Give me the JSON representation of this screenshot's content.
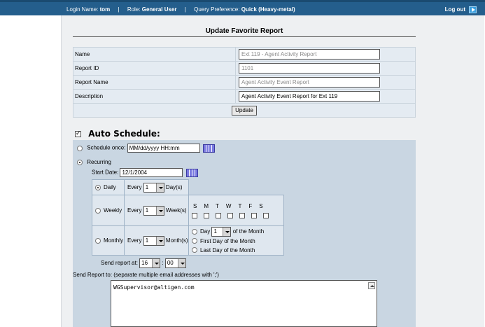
{
  "topbar": {
    "login_label": "Login Name:",
    "login_value": "tom",
    "role_label": "Role:",
    "role_value": "General User",
    "query_label": "Query Preference:",
    "query_value": "Quick (Heavy-metal)",
    "separator": "|",
    "logout": "Log out"
  },
  "title": "Update Favorite Report",
  "form": {
    "name_label": "Name",
    "name_value": "Ext 119 - Agent Activity Report",
    "id_label": "Report ID",
    "id_value": "1101",
    "report_name_label": "Report Name",
    "report_name_value": "Agent Activity Event Report",
    "description_label": "Description",
    "description_value": "Agent Activity Event Report for Ext 119",
    "update_button": "Update"
  },
  "auto_schedule": {
    "label": "Auto Schedule:",
    "checked": true,
    "schedule_once_label": "Schedule once:",
    "schedule_once_value": "MM/dd/yyyy HH:mm",
    "recurring_label": "Recurring",
    "start_date_label": "Start Date:",
    "start_date_value": "12/1/2004",
    "daily_label": "Daily",
    "every_label": "Every",
    "daily_value": "1",
    "days_label": "Day(s)",
    "weekly_label": "Weekly",
    "weekly_value": "1",
    "weeks_label": "Week(s)",
    "weekdays": [
      "S",
      "M",
      "T",
      "W",
      "T",
      "F",
      "S"
    ],
    "monthly_label": "Monthly",
    "monthly_value": "1",
    "months_label": "Month(s)",
    "day_label": "Day",
    "day_value": "1",
    "of_month_label": "of the Month",
    "first_day_label": "First Day of the Month",
    "last_day_label": "Last Day of the Month",
    "send_at_label": "Send report at:",
    "send_hour": "16",
    "time_separator": ":",
    "send_minute": "00",
    "send_to_label": "Send Report to:  (separate multiple email addresses with ';')",
    "email_value": "WGSupervisor@altigen.com"
  }
}
